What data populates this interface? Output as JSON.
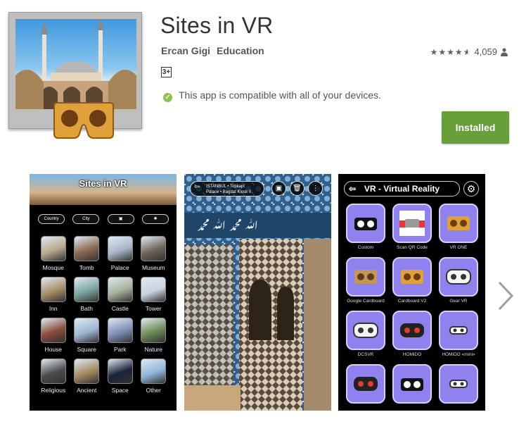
{
  "app": {
    "title": "Sites in VR",
    "developer": "Ercan Gigi",
    "category": "Education",
    "content_rating": "3+",
    "compatibility": "This app is compatible with all of your devices.",
    "rating_count": "4,059",
    "stars": 4.5,
    "install_label": "Installed"
  },
  "colors": {
    "install_green": "#689f38",
    "check_green": "#8bc34a",
    "vr_tile_purple": "#8f82ee"
  },
  "screenshot1": {
    "title": "Sites in VR",
    "buttons": [
      "Country",
      "City",
      "cardboard-icon",
      "gear-icon"
    ],
    "categories": [
      {
        "label": "Mosque",
        "color": "#b8a88a"
      },
      {
        "label": "Tomb",
        "color": "#8a6a52"
      },
      {
        "label": "Palace",
        "color": "#a9b7c9"
      },
      {
        "label": "Museum",
        "color": "#6f6558"
      },
      {
        "label": "Inn",
        "color": "#a88e66"
      },
      {
        "label": "Bath",
        "color": "#7aa5a0"
      },
      {
        "label": "Castle",
        "color": "#a5b09a"
      },
      {
        "label": "Tower",
        "color": "#c9d4e0"
      },
      {
        "label": "House",
        "color": "#8b4a3a"
      },
      {
        "label": "Square",
        "color": "#9fb6d1"
      },
      {
        "label": "Park",
        "color": "#7d8fb5"
      },
      {
        "label": "Nature",
        "color": "#6e8a55"
      },
      {
        "label": "Religious",
        "color": "#4c4c4c"
      },
      {
        "label": "Ancient",
        "color": "#a38a63"
      },
      {
        "label": "Space",
        "color": "#1b2238"
      },
      {
        "label": "Other",
        "color": "#8fb6d9"
      }
    ]
  },
  "screenshot2": {
    "location_line1": "ISTANBUL • Topkapi",
    "location_line2": "Palace • Bagdat Kiosk II"
  },
  "screenshot3": {
    "header": "VR - Virtual Reality",
    "devices": [
      {
        "label": "Custom",
        "icon": "vr-goggles-black"
      },
      {
        "label": "Scan QR Code",
        "icon": "qr-scan"
      },
      {
        "label": "VR ONE",
        "icon": "cardboard-orange"
      },
      {
        "label": "Google Cardboard",
        "icon": "cardboard-brown"
      },
      {
        "label": "Cardboard V2",
        "icon": "cardboard-orange"
      },
      {
        "label": "Gear VR",
        "icon": "vr-headset-white"
      },
      {
        "label": "DCSVR",
        "icon": "vr-headset-white"
      },
      {
        "label": "HOMiDO",
        "icon": "vr-headset-black"
      },
      {
        "label": "HOMiDO «mini»",
        "icon": "mini-goggles"
      },
      {
        "label": "",
        "icon": "vr-headset-black"
      },
      {
        "label": "",
        "icon": "vr-goggles-black"
      },
      {
        "label": "",
        "icon": "mini-goggles"
      }
    ]
  }
}
